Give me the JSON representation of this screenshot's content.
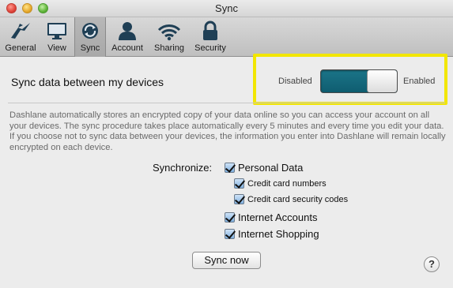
{
  "window": {
    "title": "Sync"
  },
  "toolbar": {
    "items": [
      {
        "label": "General",
        "icon": "general-icon",
        "selected": false
      },
      {
        "label": "View",
        "icon": "monitor-icon",
        "selected": false
      },
      {
        "label": "Sync",
        "icon": "sync-icon",
        "selected": true
      },
      {
        "label": "Account",
        "icon": "person-icon",
        "selected": false
      },
      {
        "label": "Sharing",
        "icon": "wifi-icon",
        "selected": false
      },
      {
        "label": "Security",
        "icon": "lock-icon",
        "selected": false
      }
    ]
  },
  "sync_toggle": {
    "label": "Sync data between my devices",
    "off_label": "Disabled",
    "on_label": "Enabled",
    "state": "enabled",
    "accent": "#156a7e",
    "highlight": "#f2e600"
  },
  "description": "Dashlane automatically stores an encrypted copy of your data online so you can access your account on all your devices. The sync procedure takes place automatically every 5 minutes and every time you edit your data. If you choose not to sync data between your devices, the information you enter into Dashlane will remain locally encrypted on each device.",
  "synchronize": {
    "caption": "Synchronize:",
    "items": [
      {
        "label": "Personal Data",
        "checked": true
      },
      {
        "label": "Credit card numbers",
        "checked": true
      },
      {
        "label": "Credit card security codes",
        "checked": true
      },
      {
        "label": "Internet Accounts",
        "checked": true
      },
      {
        "label": "Internet Shopping",
        "checked": true
      }
    ]
  },
  "buttons": {
    "sync_now": "Sync now",
    "help": "?"
  }
}
